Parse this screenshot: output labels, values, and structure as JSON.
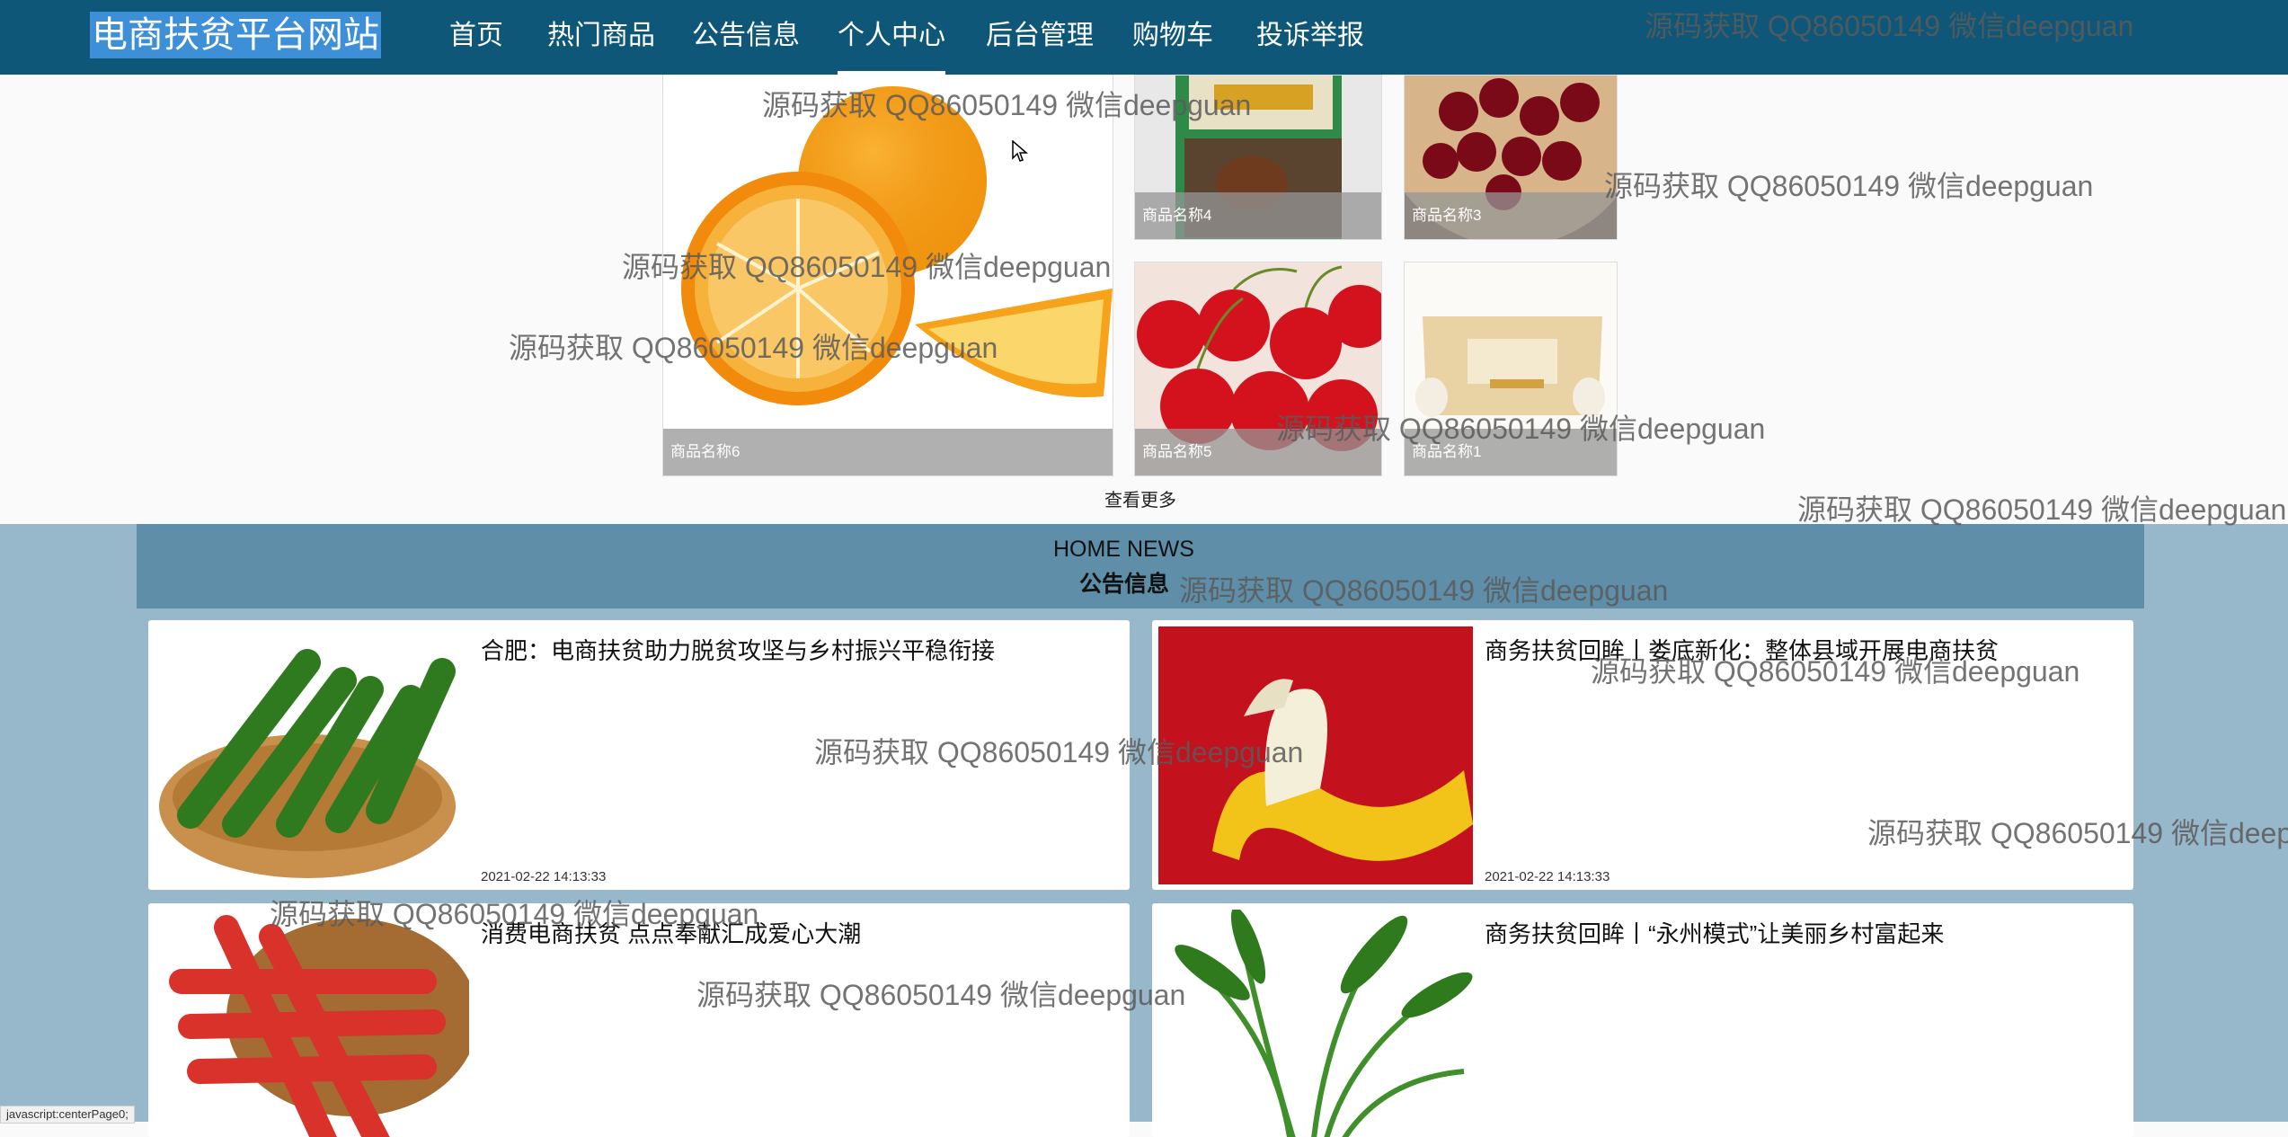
{
  "nav": {
    "brand": "电商扶贫平台网站",
    "items": [
      "首页",
      "热门商品",
      "公告信息",
      "个人中心",
      "后台管理",
      "购物车",
      "投诉举报"
    ],
    "active_index": 3
  },
  "products": {
    "items": [
      {
        "name": "商品名称6",
        "image": "orange"
      },
      {
        "name": "商品名称4",
        "image": "egg-box"
      },
      {
        "name": "商品名称3",
        "image": "cherry-plate"
      },
      {
        "name": "商品名称5",
        "image": "red-cherries"
      },
      {
        "name": "商品名称1",
        "image": "egg-carton"
      }
    ],
    "view_more": "查看更多"
  },
  "news": {
    "title_en": "HOME NEWS",
    "title_cn": "公告信息",
    "items": [
      {
        "title": "合肥：电商扶贫助力脱贫攻坚与乡村振兴平稳衔接",
        "date": "2021-02-22 14:13:33",
        "image": "cucumbers"
      },
      {
        "title": "商务扶贫回眸丨娄底新化：整体县域开展电商扶贫",
        "date": "2021-02-22 14:13:33",
        "image": "banana"
      },
      {
        "title": "消费电商扶贫 点点奉献汇成爱心大潮",
        "date": "",
        "image": "carrots"
      },
      {
        "title": "商务扶贫回眸丨“永州模式”让美丽乡村富起来",
        "date": "",
        "image": "greens"
      }
    ]
  },
  "watermark": "源码获取 QQ86050149 微信deepguan",
  "status_bar": "javascript:centerPage0;",
  "colors": {
    "nav_bg": "#0e5778",
    "brand_highlight": "#3d8fd8",
    "news_bg": "#97b7cb",
    "news_header": "#5e8ea8"
  }
}
